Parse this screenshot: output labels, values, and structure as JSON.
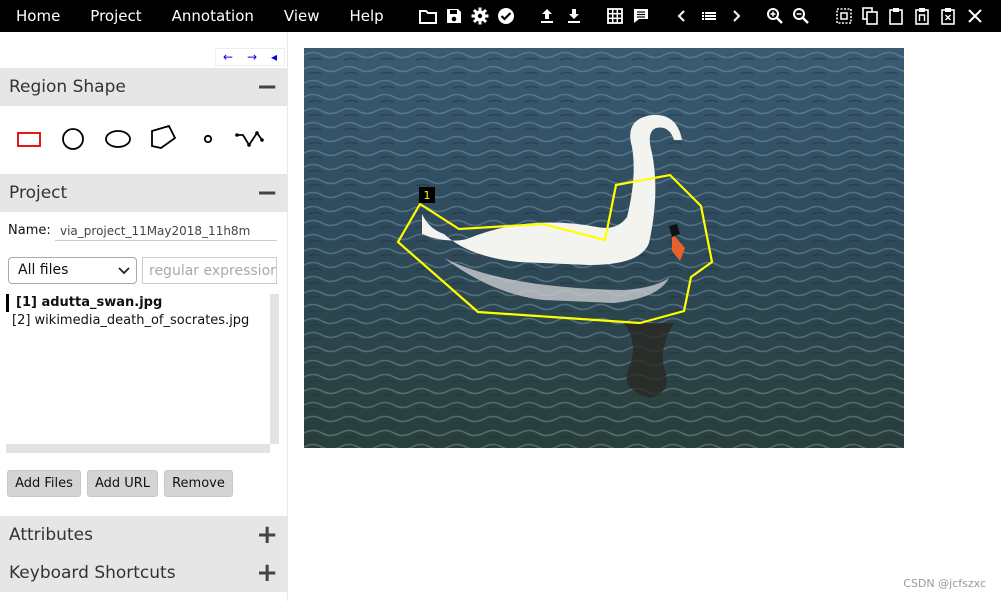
{
  "menu": [
    "Home",
    "Project",
    "Annotation",
    "View",
    "Help"
  ],
  "toolbar_icons": [
    "folder-icon",
    "save-icon",
    "gear-icon",
    "check-circle-icon",
    "upload-icon",
    "download-icon",
    "grid-icon",
    "comment-icon",
    "chevron-left-icon",
    "list-icon",
    "chevron-right-icon",
    "zoom-in-icon",
    "zoom-out-icon",
    "select-all-icon",
    "copy-icon",
    "paste-icon",
    "paste-n-icon",
    "paste-x-icon",
    "close-icon"
  ],
  "panel_nav": {
    "prev": "←",
    "next": "→",
    "collapse": "◂"
  },
  "region_shape": {
    "title": "Region Shape",
    "toggle": "−",
    "shapes": [
      "rectangle",
      "circle",
      "ellipse",
      "polygon",
      "point",
      "polyline"
    ],
    "selected": "rectangle",
    "selected_color": "#e00000"
  },
  "project": {
    "title": "Project",
    "toggle": "−",
    "name_label": "Name:",
    "name_value": "via_project_11May2018_11h8m",
    "filter_value": "All files",
    "regex_placeholder": "regular expression",
    "files": [
      {
        "label": "[1] adutta_swan.jpg",
        "active": true
      },
      {
        "label": "[2] wikimedia_death_of_socrates.jpg",
        "active": false
      }
    ],
    "buttons": {
      "add_files": "Add Files",
      "add_url": "Add URL",
      "remove": "Remove"
    }
  },
  "attributes": {
    "title": "Attributes",
    "toggle": "+"
  },
  "shortcuts": {
    "title": "Keyboard Shortcuts",
    "toggle": "+"
  },
  "canvas": {
    "region_label": "1",
    "region_color": "#ffff00"
  },
  "watermark": "CSDN @jcfszxc"
}
